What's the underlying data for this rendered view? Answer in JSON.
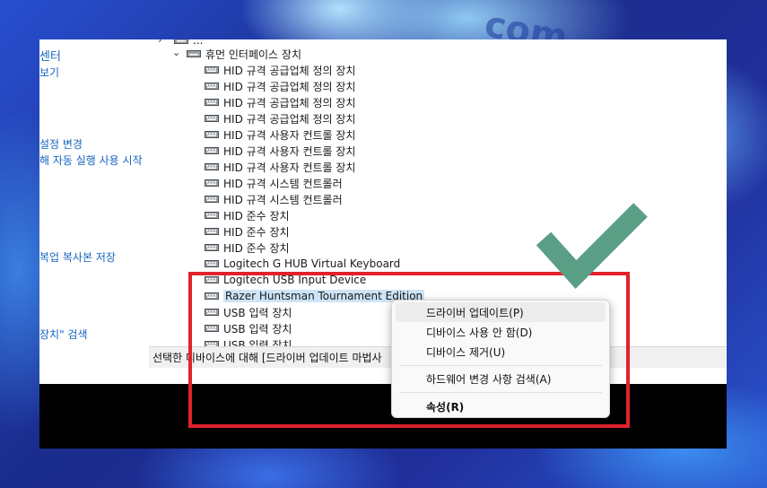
{
  "sidebar": {
    "links": [
      "센터",
      "보기",
      "설정 변경",
      "해 자동 실행 사용 시작",
      "복업 복사본 저장",
      "장치\" 검색"
    ]
  },
  "tree": {
    "partial_top": "...",
    "category": "휴먼 인터페이스 장치",
    "devices": [
      "HID 규격 공급업체 정의 장치",
      "HID 규격 공급업체 정의 장치",
      "HID 규격 공급업체 정의 장치",
      "HID 규격 공급업체 정의 장치",
      "HID 규격 사용자 컨트롤 장치",
      "HID 규격 사용자 컨트롤 장치",
      "HID 규격 사용자 컨트롤 장치",
      "HID 규격 시스템 컨트롤러",
      "HID 규격 시스템 컨트롤러",
      "HID 준수 장치",
      "HID 준수 장치",
      "HID 준수 장치",
      "Logitech G HUB Virtual Keyboard",
      "Logitech USB Input Device",
      "Razer Huntsman Tournament Edition",
      "USB 입력 장치",
      "USB 입력 장치",
      "USB 입력 장치"
    ],
    "selected_index": 14
  },
  "statusbar": {
    "text": "선택한 디바이스에 대해 [드라이버 업데이트 마법사"
  },
  "context_menu": {
    "items": [
      "드라이버 업데이트(P)",
      "디바이스 사용 안 함(D)",
      "디바이스 제거(U)",
      "하드웨어 변경 사항 검색(A)",
      "속성(R)"
    ],
    "highlighted_index": 0
  },
  "annotation": {
    "box_color": "#e1222d",
    "check_color": "#5a9e86"
  }
}
